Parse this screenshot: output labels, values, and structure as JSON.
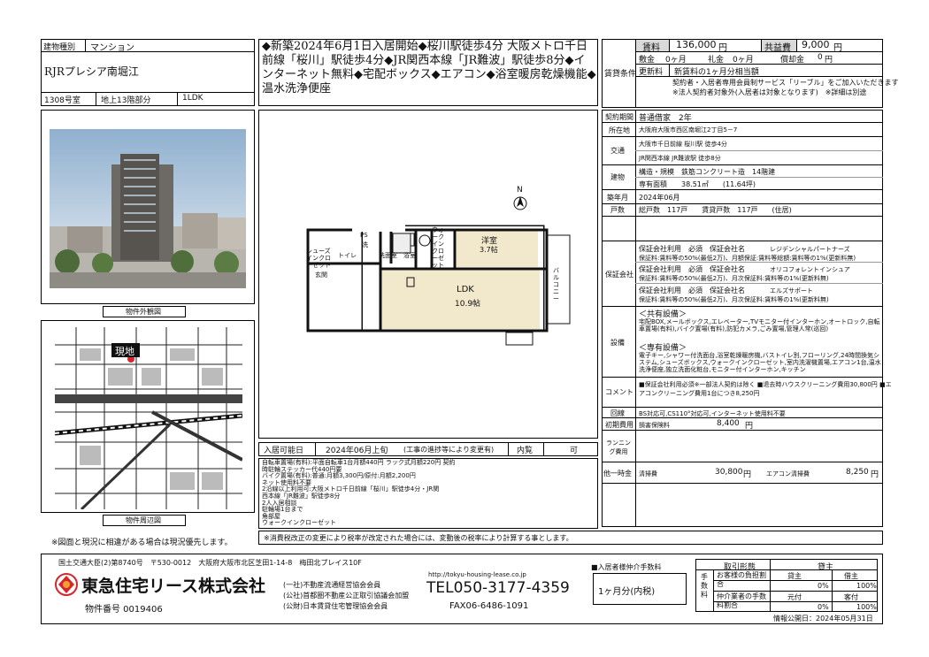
{
  "property": {
    "type_label": "建物種別",
    "type_value": "マンション",
    "name": "RJRプレシア南堀江",
    "room": "1308号室",
    "floor": "地上13階部分",
    "layout": "1LDK",
    "exterior_caption": "物件外観図",
    "map_caption": "物件周辺図",
    "map_pin": "現地",
    "footnote": "※図面と現況に相違がある場合は現況優先します。"
  },
  "headline": "◆新築2024年6月1日入居開始◆桜川駅徒歩4分 大阪メトロ千日前線「桜川」駅徒歩4分◆JR関西本線「JR難波」駅徒歩8分◆インターネット無料◆宅配ボックス◆エアコン◆浴室暖房乾燥機能◆温水洗浄便座",
  "floorplan": {
    "compass": "N",
    "rooms": {
      "western": "洋室",
      "western_size": "3.7帖",
      "ldk": "LDK",
      "ldk_size": "10.9帖",
      "bath": "浴室",
      "wash": "洗面室",
      "toilet": "トイレ",
      "entrance": "玄関",
      "closet": "ウォークイン クローゼット",
      "shoes": "シューズインクローゼット",
      "balcony": "バルコニー",
      "ps": "PS",
      "wash_short": "洗"
    }
  },
  "move_in": {
    "label": "入居可能日",
    "value": "2024年06月上旬",
    "note": "(工事の進捗等により変更有)",
    "preview_label": "内覧",
    "preview_value": "可"
  },
  "notes_block": [
    "自転車置場(有料):平面自転車1台月額440円 ラック式月額220円 契約",
    "時駐輪ステッカー代440円要",
    "バイク置場(有料):普通:月額3,300円/原付:月額2,200円",
    "ネット使用料不要",
    "2沿線以上利用可:大阪メトロ千日前線「桜川」駅徒歩4分・JR関",
    "西本線「JR難波」駅徒歩8分",
    "2人入居相談",
    "駐輪場1台まで",
    "角部屋",
    "ウォークインクローゼット"
  ],
  "tax_note": "※消費税改正の変更により税率が改定された場合には、変動後の税率により計算する事とします。",
  "conditions": {
    "section_label": "賃貸条件",
    "rent_label": "賃料",
    "rent_value": "136,000",
    "yen": "円",
    "common_label": "共益費",
    "common_value": "9,000",
    "deposit_label": "敷金",
    "deposit_value": "0ヶ月",
    "key_label": "礼金",
    "key_value": "0ヶ月",
    "amort_label": "償却金",
    "amort_value": "0",
    "renewal_label": "更新料",
    "renewal_value": "新賃料の1ヶ月分相当額",
    "service_note1": "契約者・入居者専用会員制サービス「リーブル」をご加入いただきます",
    "service_note2": "※法人契約者対象外(入居者は対象となります)　※詳細は別途"
  },
  "details": {
    "contract_label": "契約期間",
    "contract_value": "普通借家　2年",
    "address_label": "所在地",
    "address_value": "大阪府大阪市西区南堀江2丁目5－7",
    "transport_label": "交通",
    "transport_1": "大阪市千日前線 桜川駅 徒歩4分",
    "transport_2": "JR関西本線 JR難波駅 徒歩8分",
    "building_label": "建物",
    "structure": "構造・規模　鉄筋コンクリート造　14階建",
    "area": "専有面積　　38.51㎡　　(11.64坪)",
    "built_label": "築年月",
    "built_value": "2024年06月",
    "units_label": "戸数",
    "units_value": "総戸数　117戸　　賃貸戸数　117戸　　(住居)",
    "guarantee_label": "保証会社",
    "guarantee": [
      {
        "head": "保証会社利用　必須　保証会社名",
        "name": "レジデンシャルパートナーズ",
        "detail": "保証料:賃料等の50%(最低2万)、月額保証:賃料等総額:賃料等の1%(更新料無)"
      },
      {
        "head": "保証会社利用　必須　保証会社名",
        "name": "オリコフォレントインシュア",
        "detail": "保証料:賃料等の50%(最低2万)、月次保証料:賃料等の1%(更新料無)"
      },
      {
        "head": "保証会社利用　必須　保証会社名",
        "name": "エルズサポート",
        "detail": "保証料:賃料等の50%(最低2万)、月次保証料:賃料等の1%(更新料無)"
      }
    ],
    "facility_label": "設備",
    "common_fac_head": "＜共有設備＞",
    "common_fac_1": "宅配BOX,メールボックス,エレベーター,TVモニター付インターホン,オートロック,自転車置場(有料),バイク置場(有料),防犯カメラ,ごみ置場,管理人常(巡回)",
    "private_fac_head": "＜専有設備＞",
    "private_fac_1": "電子キー,シャワー付洗面台,浴室乾燥暖房機,バストイレ別,フローリング,24時間換気システム,シューズボックス,ウォークインクローゼット,室内洗濯機置場,エアコン1台,温水洗浄便座,独立洗面化粧台,モニター付インターホン,キッチン",
    "private_fac_2": "室内洗濯機置場",
    "comment_label": "コメント",
    "comment_1": "■保証会社利用必須※一部法人契約は除く ■退去時ハウスクリーニング費用30,800円 ■エ",
    "comment_2": "アコンクリーニング費用1台につき8,250円",
    "line_label": "回線",
    "line_value": "BS対応可,CS110°対応可,インターネット使用料不要",
    "initial_label": "初期費用",
    "initial_item": "損害保険料",
    "initial_value": "8,400",
    "running_label": "ランニング費用",
    "other_label": "他一時金",
    "other_item1": "清掃費",
    "other_val1": "30,800",
    "other_item2": "エアコン清掃費",
    "other_val2": "8,250"
  },
  "company": {
    "license": "国土交通大臣(2)第8740号　〒530-0012　大阪府大阪市北区芝田1-14-8　梅田北プレイス10F",
    "name": "東急住宅リース株式会社",
    "property_no": "物件番号 0019406",
    "assoc1": "(一社)不動産流通経営協会会員",
    "assoc2": "(公社)首都圏不動産公正取引協議会加盟",
    "assoc3": "(公財)日本賃貸住宅管理協会会員",
    "url": "http://tokyu-housing-lease.co.jp",
    "tel": "TEL050-3177-4359",
    "fax": "FAX06-6486-1091"
  },
  "fee_box": {
    "fee_title": "■入居者様仲介手数料",
    "fee_value": "1ヶ月分(内税)",
    "trade_label": "取引形態",
    "trade_value": "貸主",
    "commission_label": "手数料",
    "tenant_label": "お客様の負担割合",
    "agent_label": "仲介業者の手数料割合",
    "col_landlord": "貸主",
    "col_broker": "借主",
    "col_moto": "元付",
    "col_saki": "客付",
    "r1c1": "0%",
    "r1c2": "100%",
    "r2c1": "0%",
    "r2c2": "100%",
    "published": "情報公開日：2024年05月31日"
  },
  "colors": {
    "sky": "#9bb8d3",
    "gray_cell": "#d9d9d9",
    "logo_red": "#d6262c"
  }
}
